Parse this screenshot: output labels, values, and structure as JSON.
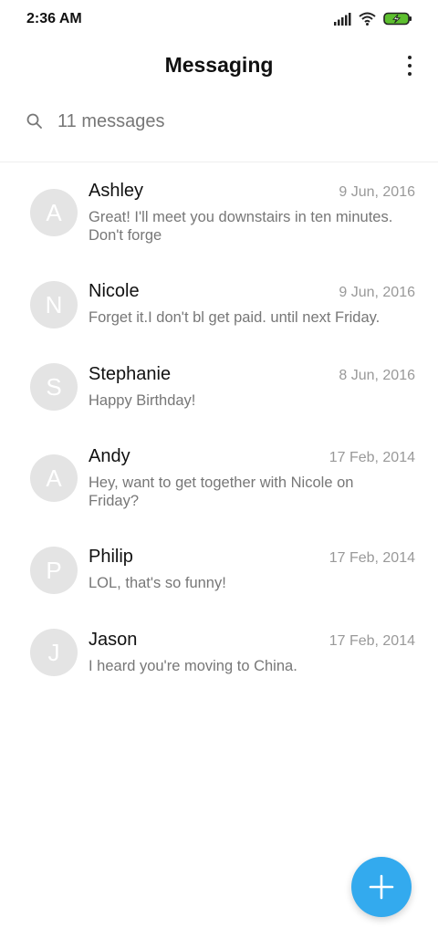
{
  "status_bar": {
    "time": "2:36 AM",
    "icons": [
      "signal-icon",
      "wifi-icon",
      "battery-charging-icon"
    ],
    "battery_color": "#5dbf2f"
  },
  "header": {
    "title": "Messaging",
    "menu_icon": "more-vert-icon"
  },
  "search": {
    "icon": "search-icon",
    "label": "11 messages"
  },
  "conversations": [
    {
      "avatar": "A",
      "name": "Ashley",
      "date": "9 Jun, 2016",
      "preview": "Great! I'll meet you downstairs in ten minutes. Don't forge"
    },
    {
      "avatar": "N",
      "name": "Nicole",
      "date": "9 Jun, 2016",
      "preview": "Forget it.I don't bl get paid. until next Friday."
    },
    {
      "avatar": "S",
      "name": "Stephanie",
      "date": "8 Jun, 2016",
      "preview": "Happy Birthday!"
    },
    {
      "avatar": "A",
      "name": "Andy",
      "date": "17 Feb, 2014",
      "preview": "Hey, want to get together with Nicole on Friday?"
    },
    {
      "avatar": "P",
      "name": "Philip",
      "date": "17 Feb, 2014",
      "preview": "LOL, that's so funny!"
    },
    {
      "avatar": "J",
      "name": "Jason",
      "date": "17 Feb, 2014",
      "preview": "I heard you're moving to China."
    }
  ],
  "fab": {
    "icon": "plus-icon",
    "color": "#33aaee"
  }
}
